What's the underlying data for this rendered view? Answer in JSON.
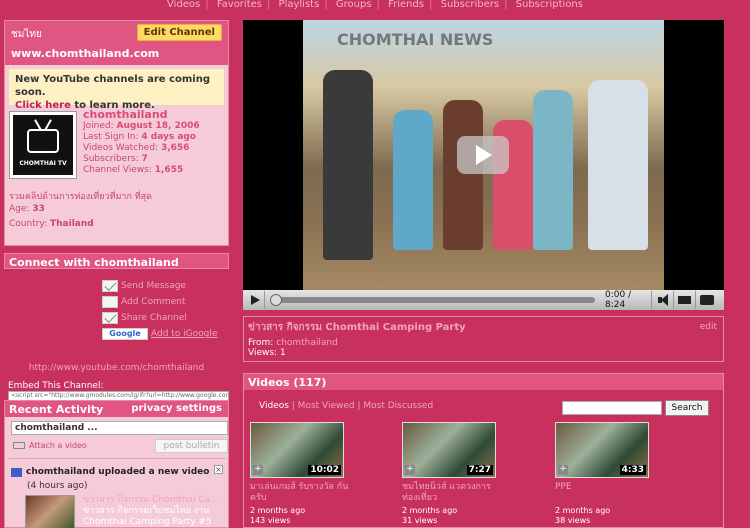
{
  "nav": {
    "items": [
      "Videos",
      "Favorites",
      "Playlists",
      "Groups",
      "Friends",
      "Subscribers",
      "Subscriptions"
    ]
  },
  "profile": {
    "channel_name": "ชมไทย",
    "edit_button": "Edit Channel",
    "url": "www.chomthailand.com",
    "notice_text": "New YouTube channels are coming soon.",
    "notice_link": "Click here",
    "notice_tail": " to learn more.",
    "avatar_brand": "CHOMTHAI TV",
    "username": "chomthailand",
    "joined_label": "Joined: ",
    "joined": "August 18, 2006",
    "last_signin_label": "Last Sign In: ",
    "last_signin": "4 days ago",
    "videos_watched_label": "Videos Watched: ",
    "videos_watched": "3,656",
    "subscribers_label": "Subscribers: ",
    "subscribers": "7",
    "channel_views_label": "Channel Views: ",
    "channel_views": "1,655",
    "tagline": "รวมคลิปด้านการท่องเที่ยวที่มาก ที่สุด",
    "age_label": "Age: ",
    "age": "33",
    "country_label": "Country: ",
    "country": "Thailand"
  },
  "connect": {
    "header": "Connect with chomthailand",
    "send_message": "Send Message",
    "add_comment": "Add Comment",
    "share_channel": "Share Channel",
    "google_label": "Google",
    "add_to_google": "Add to iGoogle",
    "channel_url": "http://www.youtube.com/chomthailand",
    "embed_label": "Embed This Channel:",
    "embed_code": "<script src=\"http://www.gmodules.com/ig/ifr?url=http://www.google.com/ig/modules/youtube.xml"
  },
  "activity": {
    "header": "Recent Activity",
    "privacy": "privacy settings",
    "input_value": "chomthailand ...",
    "attach": "Attach a video",
    "post_button": "post bulletin",
    "event": "chomthailand uploaded a new video",
    "time": "(4 hours ago)",
    "title_line1": "ข่าวสาร กิจกรรม Chomthai Ca...",
    "title_line2": "ข่าวสาร กิจกรรมเว็บชมไทย งาน",
    "title_line3": "Chomthai Camping Party #5"
  },
  "player": {
    "watermark": "CHOMTHAI NEWS",
    "time": "0:00 / 8:24",
    "progress": 0
  },
  "video_info": {
    "title": "ข่าวสาร กิจกรรม Chomthai Camping Party",
    "edit": "edit",
    "from_label": "From: ",
    "from": "chomthailand",
    "views": "Views: 1"
  },
  "videos": {
    "header": "Videos (117)",
    "tab_videos": "Videos",
    "tab_most_viewed": "Most Viewed",
    "tab_most_discussed": "Most Discussed",
    "search_button": "Search",
    "items": [
      {
        "duration": "10:02",
        "title": "มาเล่นเกมส์ รับรางวัล กันครับ",
        "age": "2 months ago",
        "views": "143 views"
      },
      {
        "duration": "7:27",
        "title": "ชมไทยนิวส์ แวดวงการท่องเที่ยว",
        "age": "2 months ago",
        "views": "31 views"
      },
      {
        "duration": "4:33",
        "title": "PPE",
        "age": "2 months ago",
        "views": "38 views"
      }
    ]
  }
}
